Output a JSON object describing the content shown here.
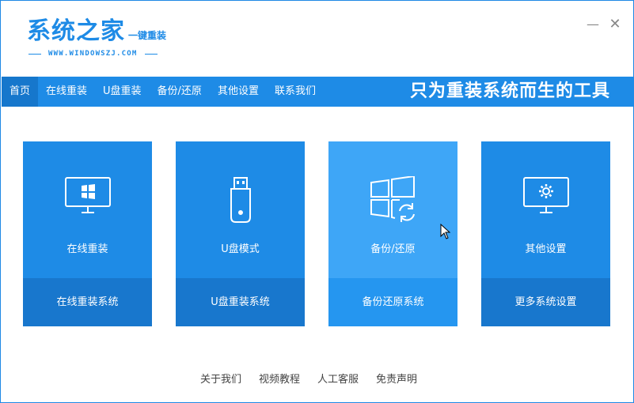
{
  "header": {
    "logo_title": "系统之家",
    "logo_suffix": "一键重装",
    "logo_url": "WWW.WINDOWSZJ.COM"
  },
  "window_controls": {
    "minimize": "—",
    "close": "✕"
  },
  "nav": {
    "items": [
      {
        "label": "首页",
        "active": true
      },
      {
        "label": "在线重装"
      },
      {
        "label": "U盘重装"
      },
      {
        "label": "备份/还原"
      },
      {
        "label": "其他设置"
      },
      {
        "label": "联系我们"
      }
    ],
    "slogan": "只为重装系统而生的工具"
  },
  "cards": [
    {
      "label": "在线重装",
      "button": "在线重装系统",
      "icon": "monitor-windows-icon"
    },
    {
      "label": "U盘模式",
      "button": "U盘重装系统",
      "icon": "usb-drive-icon"
    },
    {
      "label": "备份/还原",
      "button": "备份还原系统",
      "icon": "windows-restore-icon"
    },
    {
      "label": "其他设置",
      "button": "更多系统设置",
      "icon": "monitor-gear-icon"
    }
  ],
  "footer": {
    "links": [
      "关于我们",
      "视频教程",
      "人工客服",
      "免责声明"
    ]
  },
  "colors": {
    "primary": "#1e8be6",
    "card_bottom": "#1877cd",
    "card_hover": "#3ea6f7"
  }
}
